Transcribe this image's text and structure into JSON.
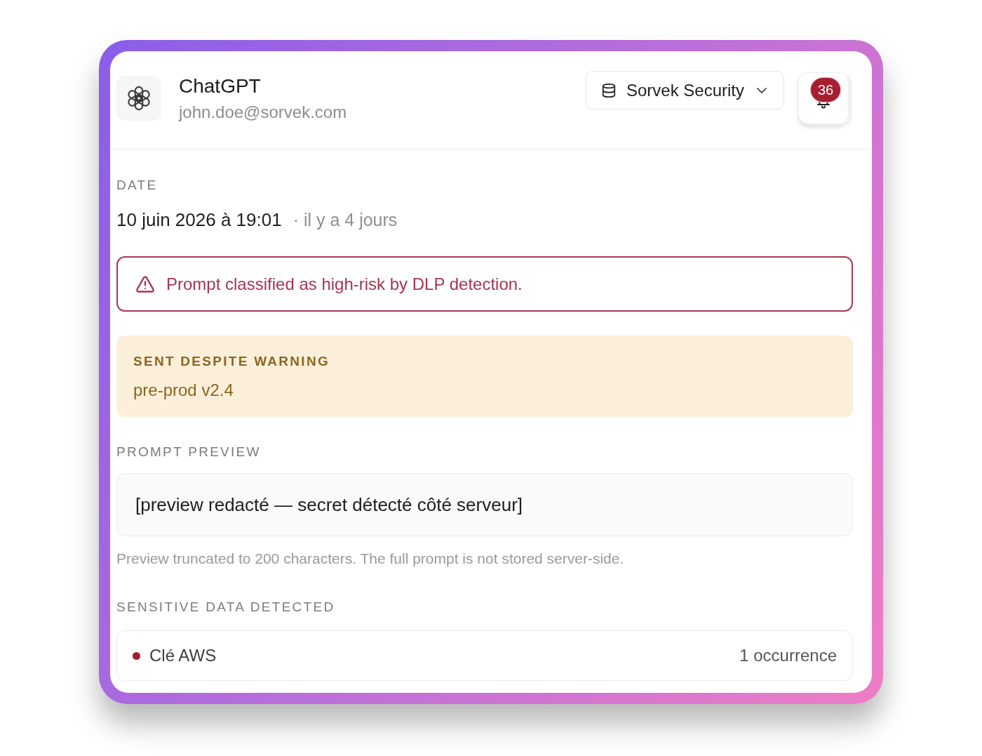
{
  "app": {
    "name": "ChatGPT",
    "email": "john.doe@sorvek.com"
  },
  "org_selector": {
    "label": "Sorvek Security"
  },
  "notifications": {
    "count": "36"
  },
  "date": {
    "label": "DATE",
    "value": "10 juin 2026 à 19:01",
    "relative": "· il y a 4 jours"
  },
  "alert": {
    "message": "Prompt classified as high-risk by DLP detection."
  },
  "override": {
    "label": "SENT DESPITE WARNING",
    "value": "pre-prod v2.4"
  },
  "prompt_preview": {
    "label": "PROMPT PREVIEW",
    "text": "[preview redacté — secret détecté côté serveur]",
    "note": "Preview truncated to 200 characters. The full prompt is not stored server-side."
  },
  "sensitive_data": {
    "label": "SENSITIVE DATA DETECTED",
    "items": [
      {
        "name": "Clé AWS",
        "count": "1 occurrence",
        "color": "#a11d2e"
      }
    ]
  }
}
